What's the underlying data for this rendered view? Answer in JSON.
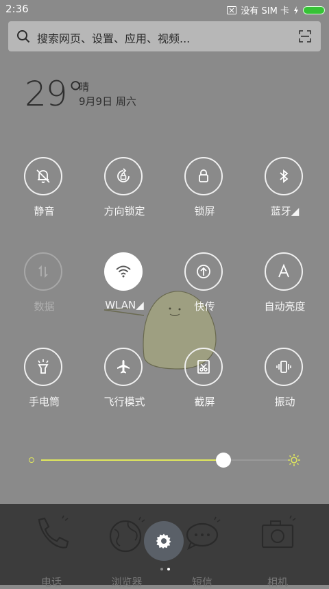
{
  "status": {
    "time": "2:36",
    "sim_text": "没有 SIM 卡",
    "battery_color": "#36c236"
  },
  "search": {
    "placeholder": "搜索网页、设置、应用、视频..."
  },
  "weather": {
    "temperature": "29°",
    "condition": "晴",
    "date": "9月9日 周六"
  },
  "toggles": [
    {
      "label": "静音",
      "icon": "bell-off-icon",
      "state": "off"
    },
    {
      "label": "方向锁定",
      "icon": "rotation-lock-icon",
      "state": "off"
    },
    {
      "label": "锁屏",
      "icon": "lock-icon",
      "state": "off"
    },
    {
      "label": "蓝牙◢",
      "icon": "bluetooth-icon",
      "state": "off"
    },
    {
      "label": "数据",
      "icon": "data-arrows-icon",
      "state": "disabled"
    },
    {
      "label": "WLAN◢",
      "icon": "wifi-icon",
      "state": "on"
    },
    {
      "label": "快传",
      "icon": "share-upload-icon",
      "state": "off"
    },
    {
      "label": "自动亮度",
      "icon": "auto-brightness-icon",
      "state": "off"
    },
    {
      "label": "手电筒",
      "icon": "flashlight-icon",
      "state": "off"
    },
    {
      "label": "飞行模式",
      "icon": "airplane-icon",
      "state": "off"
    },
    {
      "label": "截屏",
      "icon": "screenshot-icon",
      "state": "off"
    },
    {
      "label": "振动",
      "icon": "vibrate-icon",
      "state": "off"
    }
  ],
  "brightness": {
    "level": 0.74,
    "accent": "#e1e85c"
  },
  "dock": {
    "apps": [
      {
        "label": "电话",
        "icon": "phone-icon"
      },
      {
        "label": "浏览器",
        "icon": "globe-icon"
      },
      {
        "label": "短信",
        "icon": "message-icon"
      },
      {
        "label": "相机",
        "icon": "camera-icon"
      }
    ],
    "page_count": 2,
    "current_page": 1
  }
}
